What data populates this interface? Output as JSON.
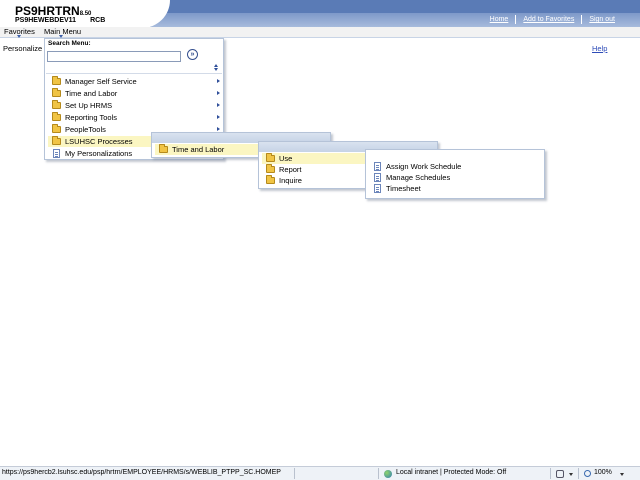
{
  "header": {
    "app_title": "PS9HRTRN",
    "version": "8.50",
    "database": "PS9HEWEBDEV11",
    "user": "RCB",
    "links": [
      "Home",
      "Add to Favorites",
      "Sign out"
    ]
  },
  "nav": {
    "favorites_label": "Favorites",
    "main_menu_label": "Main Menu"
  },
  "page": {
    "title": "Personalize",
    "help_label": "Help"
  },
  "search_menu": {
    "label": "Search Menu:",
    "value": ""
  },
  "main_menu_items": [
    {
      "label": "Manager Self Service",
      "icon": "folder-icon",
      "has_submenu": true
    },
    {
      "label": "Time and Labor",
      "icon": "folder-icon",
      "has_submenu": true
    },
    {
      "label": "Set Up HRMS",
      "icon": "folder-icon",
      "has_submenu": true
    },
    {
      "label": "Reporting Tools",
      "icon": "folder-icon",
      "has_submenu": true
    },
    {
      "label": "PeopleTools",
      "icon": "folder-icon",
      "has_submenu": true
    },
    {
      "label": "LSUHSC Processes",
      "icon": "folder-icon",
      "has_submenu": true,
      "active": true
    },
    {
      "label": "My Personalizations",
      "icon": "document-icon",
      "has_submenu": false
    }
  ],
  "submenu_lsuhsc": [
    {
      "label": "Time and Labor",
      "icon": "folder-icon",
      "active": true
    }
  ],
  "submenu_time_labor": [
    {
      "label": "Use",
      "icon": "folder-icon",
      "active": true
    },
    {
      "label": "Report",
      "icon": "folder-icon"
    },
    {
      "label": "Inquire",
      "icon": "folder-icon"
    }
  ],
  "submenu_use": [
    {
      "label": "Assign Work Schedule",
      "icon": "document-icon"
    },
    {
      "label": "Manage Schedules",
      "icon": "document-icon"
    },
    {
      "label": "Timesheet",
      "icon": "document-icon"
    }
  ],
  "status_bar": {
    "url": "https://ps9hercb2.lsuhsc.edu/psp/hrtrn/EMPLOYEE/HRMS/s/WEBLIB_PTPP_SC.HOMEP",
    "zone": "Local intranet | Protected Mode: Off",
    "zoom": "100%"
  },
  "colors": {
    "header_blue": "#5a7bb6",
    "menu_header": "#c6d3e6",
    "menu_highlight": "#fbf6c2",
    "link_blue": "#2e4cb8"
  }
}
